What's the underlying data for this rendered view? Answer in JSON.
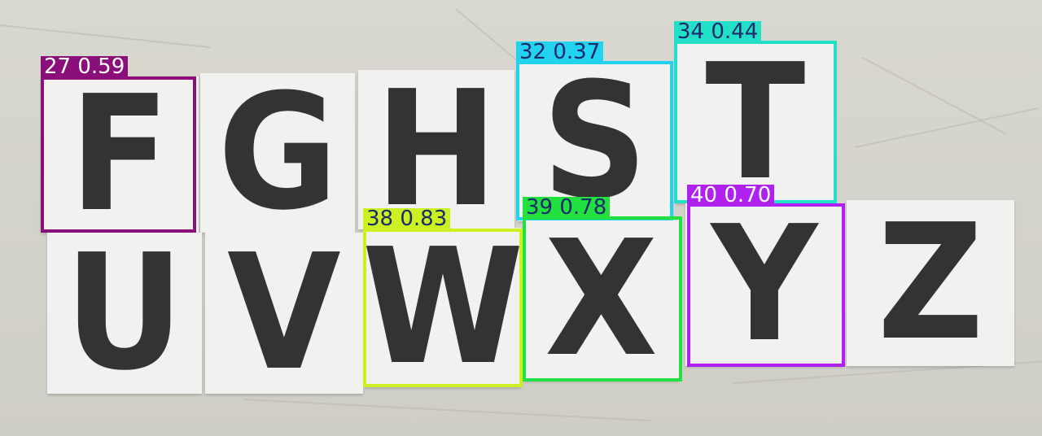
{
  "cards": [
    {
      "name": "card-F",
      "letter": "F"
    },
    {
      "name": "card-G",
      "letter": "G"
    },
    {
      "name": "card-H",
      "letter": "H"
    },
    {
      "name": "card-S",
      "letter": "S"
    },
    {
      "name": "card-T",
      "letter": "T"
    },
    {
      "name": "card-U",
      "letter": "U"
    },
    {
      "name": "card-V",
      "letter": "V"
    },
    {
      "name": "card-W",
      "letter": "W"
    },
    {
      "name": "card-X",
      "letter": "X"
    },
    {
      "name": "card-Y",
      "letter": "Y"
    },
    {
      "name": "card-Z",
      "letter": "Z"
    }
  ],
  "detections": [
    {
      "label": "27 0.59",
      "color": "#8a0f7a",
      "text_color": "#ffffff"
    },
    {
      "label": "32 0.37",
      "color": "#22d3f0",
      "text_color": "#1b2a6b"
    },
    {
      "label": "34 0.44",
      "color": "#22e0c8",
      "text_color": "#1b2a6b"
    },
    {
      "label": "38 0.83",
      "color": "#ccf020",
      "text_color": "#1b2a6b"
    },
    {
      "label": "39 0.78",
      "color": "#22e040",
      "text_color": "#1b2a6b"
    },
    {
      "label": "40 0.70",
      "color": "#b020f0",
      "text_color": "#ffffff"
    }
  ]
}
